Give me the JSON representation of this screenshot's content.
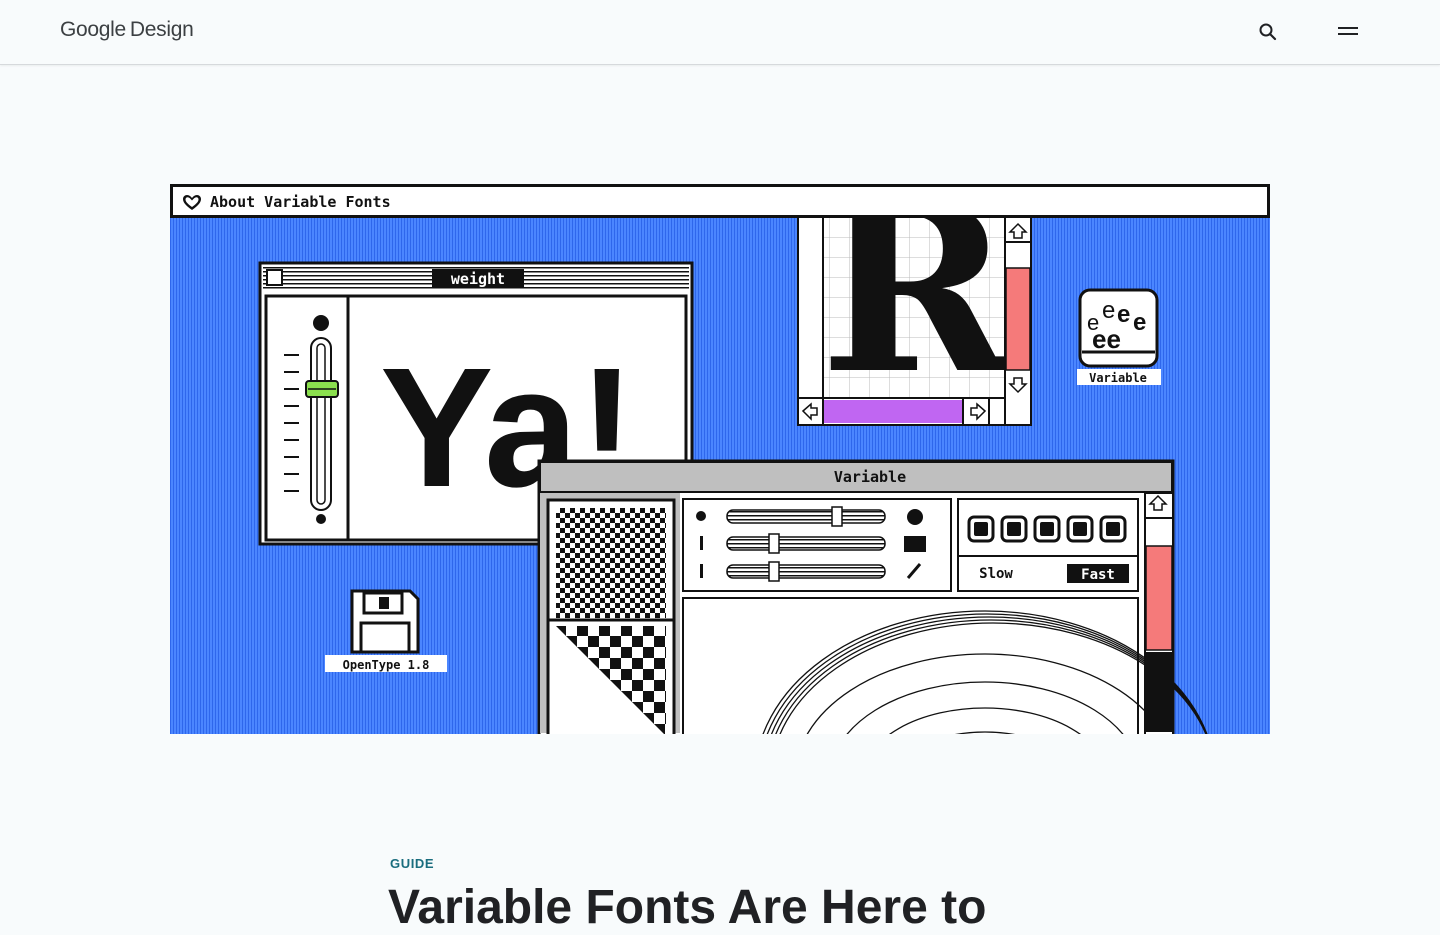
{
  "header": {
    "brand_google": "Google",
    "brand_design": "Design"
  },
  "hero": {
    "window_title": "About Variable Fonts",
    "weight_label": "weight",
    "sample_text": "Ya!",
    "glyph": "R",
    "variable_icon_letters": "eeeee",
    "variable_icon_label": "Variable",
    "opentype_label": "OpenType 1.8",
    "variable_window_title": "Variable",
    "slow_label": "Slow",
    "fast_label": "Fast"
  },
  "article": {
    "kicker": "GUIDE",
    "title": "Variable Fonts Are Here to"
  },
  "colors": {
    "accent_blue": "#3b77f5",
    "slider_green": "#8be04e",
    "scroll_red": "#f57a7a",
    "scroll_purple": "#c066f2",
    "kicker_teal": "#1a6d7e"
  }
}
